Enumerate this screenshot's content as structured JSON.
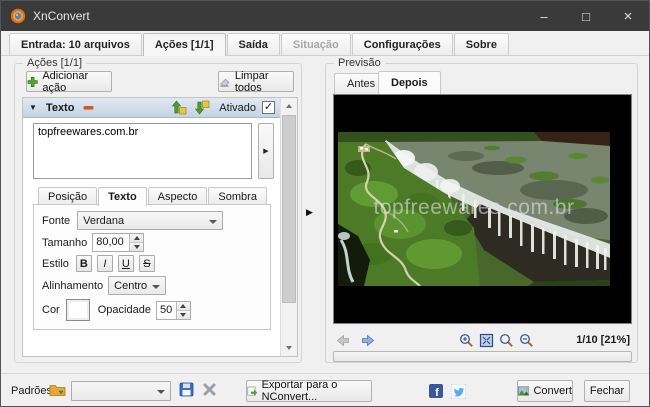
{
  "window": {
    "title": "XnConvert",
    "controls": {
      "minimize": "–",
      "maximize": "□",
      "close": "×"
    }
  },
  "tabs": [
    {
      "label": "Entrada: 10 arquivos",
      "state": "normal"
    },
    {
      "label": "Ações [1/1]",
      "state": "active"
    },
    {
      "label": "Saída",
      "state": "normal"
    },
    {
      "label": "Situação",
      "state": "disabled"
    },
    {
      "label": "Configurações",
      "state": "normal"
    },
    {
      "label": "Sobre",
      "state": "normal"
    }
  ],
  "actions": {
    "group_title": "Ações [1/1]",
    "add_label": "Adicionar ação",
    "clear_label": "Limpar todos",
    "item": {
      "collapse_glyph": "▼",
      "title": "Texto",
      "enabled_label": "Ativado",
      "check_glyph": "✓",
      "text": "topfreewares.com.br",
      "expand_glyph": "▶",
      "tabs": [
        "Posição",
        "Texto",
        "Aspecto",
        "Sombra"
      ],
      "form": {
        "font_label": "Fonte",
        "font_value": "Verdana",
        "size_label": "Tamanho",
        "size_value": "80,00",
        "style_label": "Estilo",
        "style_buttons": [
          "B",
          "I",
          "U",
          "S"
        ],
        "align_label": "Alinhamento",
        "align_value": "Centro",
        "color_label": "Cor",
        "opacity_label": "Opacidade",
        "opacity_value": "50"
      }
    }
  },
  "preview": {
    "group_title": "Previsão",
    "tab_before": "Antes",
    "tab_after": "Depois",
    "watermark": "topfreewares.com.br",
    "page_info": "1/10 [21%]"
  },
  "splitter_glyph": "▶",
  "bottom": {
    "presets_label": "Padrões:",
    "export_label": "Exportar para o NConvert...",
    "facebook_glyph": "f",
    "convert_label": "Convert",
    "close_label": "Fechar"
  },
  "colors": {
    "titlebar": "#3a3a3a",
    "action_header": "#c5d3e2",
    "watermark": "rgba(228,231,233,0.58)",
    "facebook": "#3b5998",
    "twitter_bird": "#55acee"
  }
}
